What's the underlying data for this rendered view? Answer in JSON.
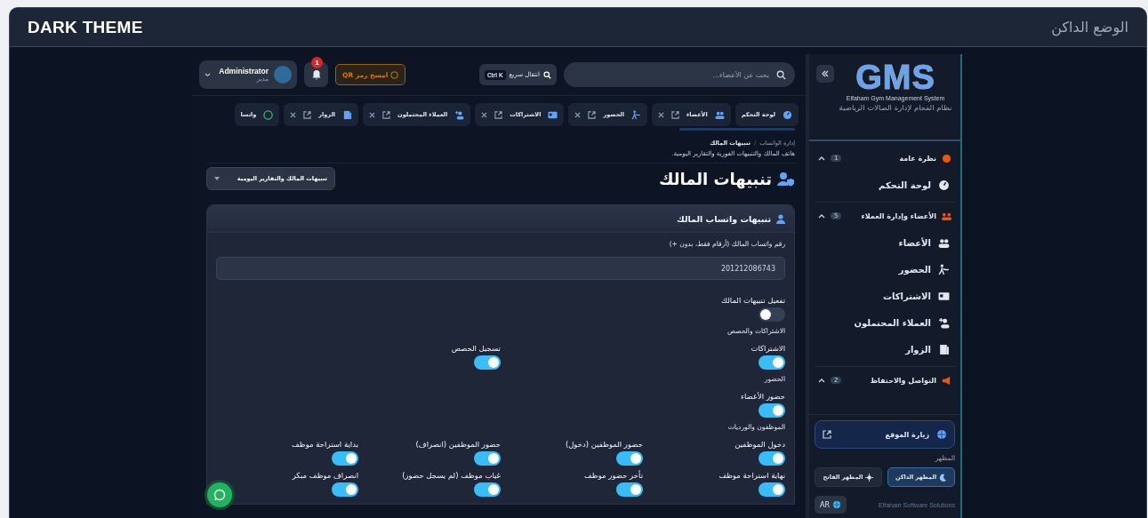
{
  "frame": {
    "title": "DARK THEME",
    "title_ar": "الوضع الداكن"
  },
  "topbar": {
    "search": {
      "placeholder": "بحث عن الأعضاء..."
    },
    "quick": {
      "label": "انتقال سريع",
      "shortcut": "Ctrl K"
    },
    "qr_button": "امسح رمز QR",
    "notifications": {
      "count": "1"
    },
    "user": {
      "name": "Administrator",
      "role": "مدير"
    }
  },
  "tabs": [
    {
      "label": "لوحة التحكم",
      "closable": false
    },
    {
      "label": "الأعضاء",
      "closable": true
    },
    {
      "label": "الحضور",
      "closable": true
    },
    {
      "label": "الاشتراكات",
      "closable": true
    },
    {
      "label": "العملاء المحتملون",
      "closable": true
    },
    {
      "label": "الزوار",
      "closable": true
    },
    {
      "label": "واتسا",
      "closable": false
    }
  ],
  "breadcrumb": {
    "items": [
      "إدارة الواتساب",
      "تنبيهات المالك"
    ],
    "separator": "/"
  },
  "subtitle": "هاتف المالك والتنبيهات الفورية والتقارير اليومية.",
  "page_title": "تنبيهات المالك",
  "section_select": "تنبيهات المالك والتقارير اليومية",
  "card": {
    "title": "تنبيهات واتساب المالك",
    "phone_label": "رقم واتساب المالك (أرقام فقط، بدون +)",
    "phone_value": "201212086743",
    "enable": {
      "label": "تفعيل تنبيهات المالك",
      "on": false
    },
    "groups": [
      {
        "title": "الاشتراكات والحصص",
        "items": [
          {
            "label": "الاشتراكات",
            "on": true
          },
          {
            "label": "تسجيل الحصص",
            "on": true
          }
        ]
      },
      {
        "title": "الحضور",
        "items": [
          {
            "label": "حضور الأعضاء",
            "on": true
          }
        ]
      },
      {
        "title": "الموظفون والورديات",
        "items": [
          {
            "label": "دخول الموظفين",
            "on": true
          },
          {
            "label": "حضور الموظفين (دخول)",
            "on": true
          },
          {
            "label": "حضور الموظفين (انصراف)",
            "on": true
          },
          {
            "label": "بداية استراحة موظف",
            "on": true
          },
          {
            "label": "نهاية استراحة موظف",
            "on": true
          },
          {
            "label": "تأخر حضور موظف",
            "on": true
          },
          {
            "label": "غياب موظف (لم يسجل حضور)",
            "on": true
          },
          {
            "label": "انصراف موظف مبكر",
            "on": true
          }
        ]
      }
    ]
  },
  "sidebar": {
    "logo": "GMS",
    "logo_caption": "Elfaham Gym Management System",
    "app_name": "نظام الفحام لإدارة الصالات الرياضية",
    "sections": [
      {
        "title": "نظرة عامة",
        "count": "1",
        "expanded": true,
        "items": [
          "لوحة التحكم"
        ]
      },
      {
        "title": "الأعضاء وإدارة العملاء",
        "count": "5",
        "expanded": true,
        "items": [
          "الأعضاء",
          "الحضور",
          "الاشتراكات",
          "العملاء المحتملون",
          "الزوار"
        ]
      },
      {
        "title": "التواصل والاحتفاظ",
        "count": "2",
        "expanded": true
      }
    ],
    "visit_site": "زيارة الموقع",
    "appearance_label": "المظهر",
    "themes": [
      {
        "label": "المظهر الداكن",
        "selected": true
      },
      {
        "label": "المظهر الفاتح",
        "selected": false
      }
    ],
    "language": "AR",
    "footer": "Elfaham Software Solutions"
  }
}
